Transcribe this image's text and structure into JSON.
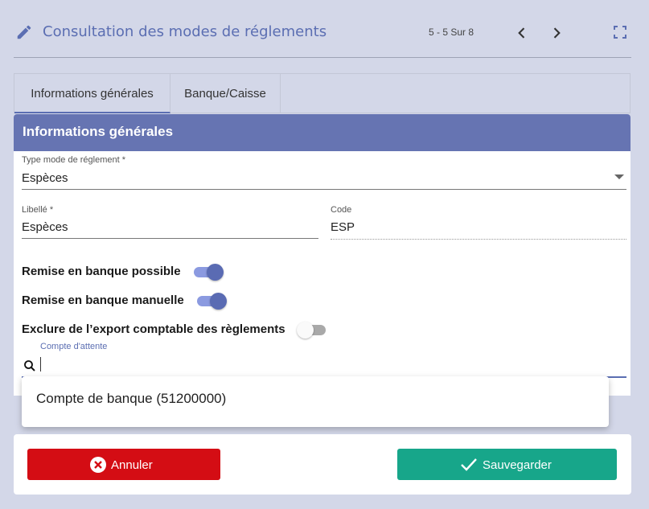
{
  "header": {
    "title": "Consultation des modes de réglements",
    "pager": "5 - 5 Sur 8",
    "icons": [
      "pencil-icon",
      "chevron-left-icon",
      "chevron-right-icon",
      "fullscreen-icon"
    ]
  },
  "tabs": [
    {
      "label": "Informations générales",
      "active": true
    },
    {
      "label": "Banque/Caisse",
      "active": false
    }
  ],
  "panel": {
    "title": "Informations générales",
    "type_field": {
      "label": "Type mode de réglement *",
      "value": "Espèces"
    },
    "libelle_field": {
      "label": "Libellé *",
      "value": "Espèces"
    },
    "code_field": {
      "label": "Code",
      "value": "ESP"
    },
    "toggles": [
      {
        "label": "Remise en banque possible",
        "on": true
      },
      {
        "label": "Remise en banque manuelle",
        "on": true
      },
      {
        "label": "Exclure de l’export comptable des règlements",
        "on": false
      }
    ],
    "compte_attente": {
      "label": "Compte d'attente",
      "value": ""
    }
  },
  "dropdown": {
    "options": [
      "Compte de banque (51200000)"
    ]
  },
  "footer": {
    "cancel_label": "Annuler",
    "save_label": "Sauvegarder"
  },
  "colors": {
    "accent": "#5b6eb2",
    "panel_header": "#6674b2",
    "cancel": "#d40d14",
    "save": "#17a68a",
    "background": "#d3d7e8"
  }
}
